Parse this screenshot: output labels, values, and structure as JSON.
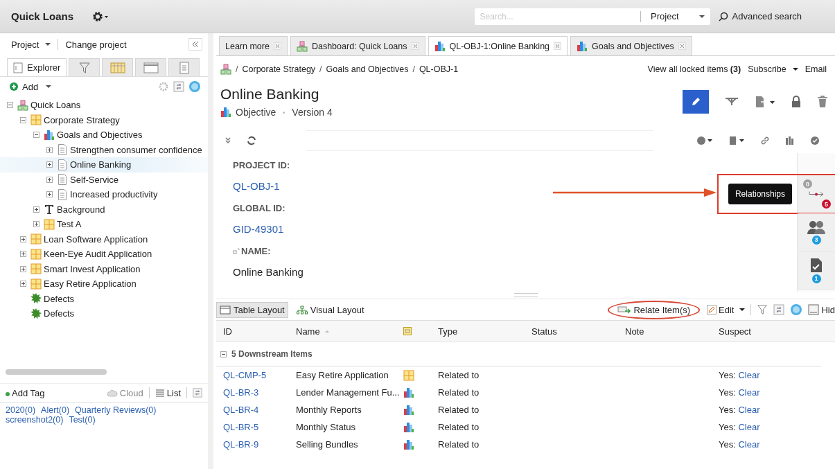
{
  "app": {
    "title": "Quick Loans"
  },
  "search": {
    "placeholder": "Search...",
    "scope": "Project",
    "advanced": "Advanced search"
  },
  "sidebar": {
    "project_menu": "Project",
    "change_project": "Change project",
    "tabs": [
      {
        "kind": "explorer",
        "label": "Explorer",
        "selected": true
      },
      {
        "kind": "filter",
        "selected": false
      },
      {
        "kind": "grid",
        "selected": false
      },
      {
        "kind": "window",
        "selected": false
      },
      {
        "kind": "doc",
        "selected": false
      }
    ],
    "add": "Add",
    "tree": [
      {
        "label": "Quick Loans",
        "kind": "project",
        "expanded": true,
        "selected": false,
        "children": [
          {
            "label": "Corporate Strategy",
            "kind": "component",
            "expanded": true,
            "selected": false,
            "children": [
              {
                "label": "Goals and Objectives",
                "kind": "objset",
                "expanded": true,
                "selected": false,
                "children": [
                  {
                    "label": "Strengthen consumer confidence",
                    "kind": "objective",
                    "expanded": false,
                    "selected": false
                  },
                  {
                    "label": "Online Banking",
                    "kind": "objective",
                    "expanded": false,
                    "selected": true
                  },
                  {
                    "label": "Self-Service",
                    "kind": "objective",
                    "expanded": false,
                    "selected": false
                  },
                  {
                    "label": "Increased productivity",
                    "kind": "objective",
                    "expanded": false,
                    "selected": false
                  }
                ]
              },
              {
                "label": "Background",
                "kind": "text",
                "expanded": false,
                "selected": false
              },
              {
                "label": "Test A",
                "kind": "component",
                "expanded": false,
                "selected": false
              }
            ]
          },
          {
            "label": "Loan Software Application",
            "kind": "component",
            "expanded": false,
            "selected": false
          },
          {
            "label": "Keen-Eye Audit Application",
            "kind": "component",
            "expanded": false,
            "selected": false
          },
          {
            "label": "Smart Invest Application",
            "kind": "component",
            "expanded": false,
            "selected": false
          },
          {
            "label": "Easy Retire Application",
            "kind": "component",
            "expanded": false,
            "selected": false
          },
          {
            "label": "Defects",
            "kind": "defect",
            "selected": false
          },
          {
            "label": "Defects",
            "kind": "defect",
            "selected": false
          }
        ]
      }
    ],
    "tag_toolbar": {
      "add": "Add Tag",
      "cloud": "Cloud",
      "list": "List"
    },
    "tags": [
      "2020(0)",
      "Alert(0)",
      "Quarterly Reviews(0)",
      "screenshot2(0)",
      "Test(0)"
    ]
  },
  "doc_tabs": [
    {
      "label": "Learn more",
      "kind": "none",
      "selected": false
    },
    {
      "label": "Dashboard: Quick Loans",
      "kind": "project",
      "selected": false
    },
    {
      "label": "QL-OBJ-1:Online Banking",
      "kind": "objset",
      "selected": true
    },
    {
      "label": "Goals and Objectives",
      "kind": "objset",
      "selected": false
    }
  ],
  "breadcrumb": [
    {
      "separator": "/",
      "label": "Corporate Strategy"
    },
    {
      "separator": "/",
      "label": "Goals and Objectives"
    },
    {
      "separator": "/",
      "label": "QL-OBJ-1"
    }
  ],
  "header_links": {
    "locked": "View all locked items **(3)**",
    "subscribe": "Subscribe",
    "email": "Email"
  },
  "item": {
    "title": "Online Banking",
    "type": "Objective",
    "version": "Version 4"
  },
  "fields": [
    {
      "label": "PROJECT ID:",
      "value": "QL-OBJ-1",
      "link": true,
      "kind": "plain"
    },
    {
      "label": "GLOBAL ID:",
      "value": "GID-49301",
      "link": true,
      "kind": "plain"
    },
    {
      "label": "NAME:",
      "value": "Online Banking",
      "link": false,
      "kind": "name"
    }
  ],
  "rail": [
    {
      "kind": "relationships",
      "tooltip": "Relationships",
      "highlighted": true,
      "badges": [
        {
          "text": "0",
          "color": "#a0a0a0"
        },
        {
          "text": "5",
          "color": "#c8102e"
        }
      ]
    },
    {
      "kind": "people",
      "highlighted": false,
      "badges": [
        {
          "text": "3",
          "color": "#1a9ce0"
        }
      ]
    },
    {
      "kind": "review",
      "highlighted": false,
      "badges": [
        {
          "text": "1",
          "color": "#1a9ce0"
        }
      ]
    }
  ],
  "relations": {
    "layouts": [
      {
        "label": "Table Layout",
        "kind": "table",
        "selected": true
      },
      {
        "label": "Visual Layout",
        "kind": "visual",
        "selected": false
      }
    ],
    "relate": {
      "label": "Relate Item(s)",
      "highlighted": true
    },
    "edit": "Edit",
    "hide": "Hid",
    "columns": [
      {
        "kind": "text",
        "label": "ID"
      },
      {
        "kind": "sort",
        "label": "Name"
      },
      {
        "kind": "icon"
      },
      {
        "kind": "text",
        "label": "Type"
      },
      {
        "kind": "text",
        "label": "Status"
      },
      {
        "kind": "text",
        "label": "Note"
      },
      {
        "kind": "text",
        "label": "Suspect"
      }
    ],
    "group": {
      "label": "5 Downstream Items",
      "expanded": true
    },
    "rows": [
      {
        "id": "QL-CMP-5",
        "name": "Easy Retire Application",
        "kind": "component",
        "type": "Related to",
        "suspect": "Yes:",
        "action": "Clear"
      },
      {
        "id": "QL-BR-3",
        "name": "Lender Management Fu...",
        "kind": "objset",
        "type": "Related to",
        "suspect": "Yes:",
        "action": "Clear"
      },
      {
        "id": "QL-BR-4",
        "name": "Monthly Reports",
        "kind": "objset",
        "type": "Related to",
        "suspect": "Yes:",
        "action": "Clear"
      },
      {
        "id": "QL-BR-5",
        "name": "Monthly Status",
        "kind": "objset",
        "type": "Related to",
        "suspect": "Yes:",
        "action": "Clear"
      },
      {
        "id": "QL-BR-9",
        "name": "Selling Bundles",
        "kind": "objset",
        "type": "Related to",
        "suspect": "Yes:",
        "action": "Clear"
      }
    ]
  }
}
